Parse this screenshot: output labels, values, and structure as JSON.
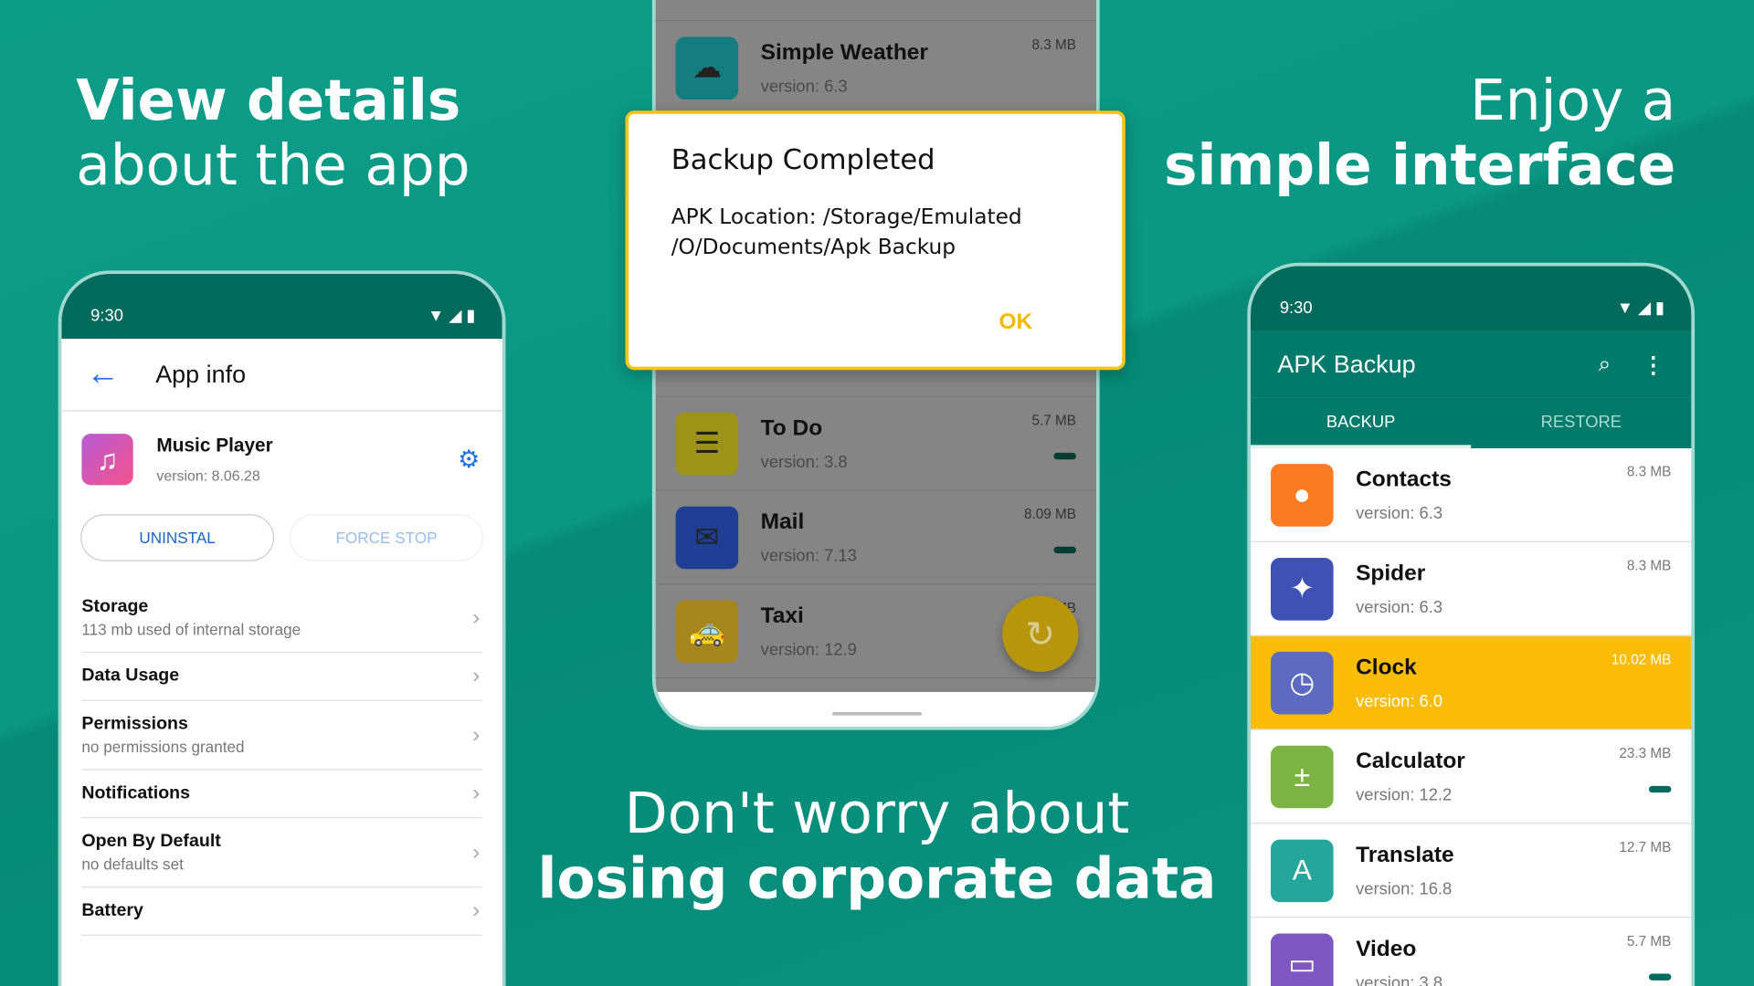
{
  "headlines": {
    "left": {
      "line1": "View details",
      "line2": "about the app"
    },
    "right": {
      "line1": "Enjoy a",
      "line2": "simple interface"
    },
    "center": {
      "line1": "Don't worry about",
      "line2": "losing corporate data"
    }
  },
  "colors": {
    "background": "#0a927f",
    "status_bar": "#006b5c",
    "toolbar": "#00796b",
    "highlight": "#fbbc05",
    "dialog_border": "#f5c518",
    "accent_blue": "#1a73e8"
  },
  "left_phone": {
    "time": "9:30",
    "title": "App info",
    "app": {
      "name": "Music Player",
      "version": "version: 8.06.28",
      "icon": "music-note-icon"
    },
    "buttons": {
      "uninstall": "UNINSTAL",
      "force_stop": "FORCE STOP"
    },
    "items": [
      {
        "title": "Storage",
        "subtitle": "113 mb used of internal storage"
      },
      {
        "title": "Data Usage",
        "subtitle": ""
      },
      {
        "title": "Permissions",
        "subtitle": "no permissions granted"
      },
      {
        "title": "Notifications",
        "subtitle": ""
      },
      {
        "title": "Open By Default",
        "subtitle": "no defaults set"
      },
      {
        "title": "Battery",
        "subtitle": ""
      }
    ]
  },
  "center_phone": {
    "apps": [
      {
        "name": "Simple Weather",
        "version": "version: 6.3",
        "size": "8.3 MB",
        "icon": "cloud-icon"
      },
      {
        "name": "To Do",
        "version": "version: 3.8",
        "size": "5.7 MB",
        "icon": "checklist-icon"
      },
      {
        "name": "Mail",
        "version": "version: 7.13",
        "size": "8.09 MB",
        "icon": "mail-icon"
      },
      {
        "name": "Taxi",
        "version": "version: 12.9",
        "size": "21.06 MB",
        "icon": "taxi-icon"
      }
    ],
    "dialog": {
      "title": "Backup Completed",
      "message_line1": "APK Location: /Storage/Emulated",
      "message_line2": "/O/Documents/Apk Backup",
      "ok": "OK"
    }
  },
  "right_phone": {
    "time": "9:30",
    "title": "APK Backup",
    "tabs": [
      {
        "label": "BACKUP",
        "active": true
      },
      {
        "label": "RESTORE",
        "active": false
      }
    ],
    "apps": [
      {
        "name": "Contacts",
        "version": "version: 6.3",
        "size": "8.3 MB",
        "icon": "person-icon",
        "color": "#fb7a24"
      },
      {
        "name": "Spider",
        "version": "version: 6.3",
        "size": "8.3 MB",
        "icon": "cards-icon",
        "color": "#3f51b5"
      },
      {
        "name": "Clock",
        "version": "version: 6.0",
        "size": "10.02 MB",
        "icon": "clock-icon",
        "color": "#5c6bc0",
        "selected": true
      },
      {
        "name": "Calculator",
        "version": "version: 12.2",
        "size": "23.3 MB",
        "icon": "calculator-icon",
        "color": "#7cb342"
      },
      {
        "name": "Translate",
        "version": "version: 16.8",
        "size": "12.7 MB",
        "icon": "translate-icon",
        "color": "#26a69a"
      },
      {
        "name": "Video",
        "version": "version: 3.8",
        "size": "5.7 MB",
        "icon": "video-icon",
        "color": "#7e57c2"
      }
    ]
  }
}
